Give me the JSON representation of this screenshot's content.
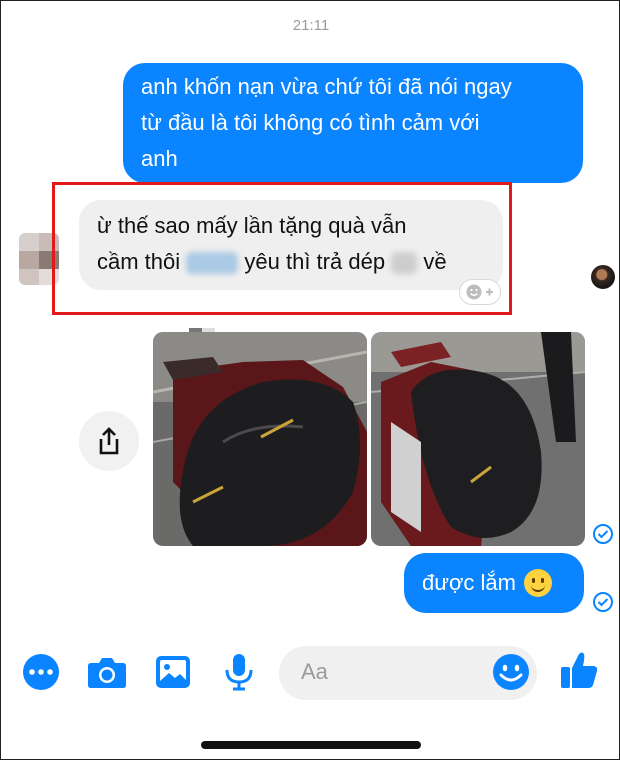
{
  "thread": {
    "timestamp": "21:11",
    "messages": [
      {
        "id": "m1",
        "direction": "outgoing",
        "lines": [
          "anh khốn nạn vừa chứ tôi đã nói ngay",
          "từ đầu là tôi không có tình cảm với",
          "anh"
        ]
      },
      {
        "id": "m2",
        "direction": "incoming",
        "line1": "ừ thế sao mấy lần tặng quà vẫn",
        "line2_a": "cầm thôi",
        "line2_b": "yêu thì trả dép",
        "line2_c": "về",
        "highlighted": true
      },
      {
        "id": "m3",
        "direction": "incoming",
        "type": "photos",
        "photos": [
          "motorbike-seat-photo-1",
          "motorbike-seat-photo-2"
        ]
      },
      {
        "id": "m4",
        "direction": "outgoing",
        "text": "được lắm",
        "emoji": "🙂"
      }
    ],
    "status": "seen"
  },
  "composer": {
    "placeholder": "Aa",
    "icons": [
      "more-icon",
      "camera-icon",
      "gallery-icon",
      "microphone-icon",
      "emoji-icon",
      "like-icon"
    ]
  },
  "colors": {
    "accent": "#0a84ff",
    "incoming_bubble": "#efefef",
    "highlight": "#e11919"
  }
}
